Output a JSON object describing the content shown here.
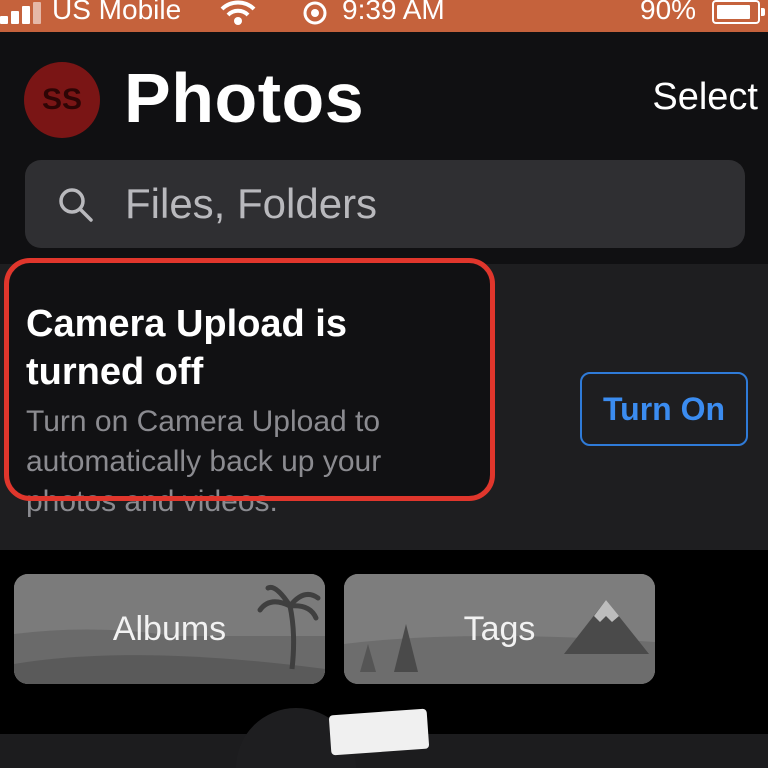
{
  "status_bar": {
    "carrier": "US Mobile",
    "time": "9:39 AM",
    "battery": "90%",
    "battery_level": 0.9
  },
  "header": {
    "avatar_initials": "SS",
    "title": "Photos",
    "select_label": "Select"
  },
  "search": {
    "placeholder": "Files, Folders"
  },
  "camera_upload": {
    "title": "Camera Upload is turned off",
    "description": "Turn on Camera Upload to automatically back up your photos and videos.",
    "button_label": "Turn On"
  },
  "tiles": [
    {
      "label": "Albums"
    },
    {
      "label": "Tags"
    }
  ],
  "colors": {
    "status_bar": "#c5623c",
    "background": "#101012",
    "accent_blue": "#3b8cf0",
    "highlight_red": "#e0362c",
    "avatar": "#7a1515"
  },
  "icons": [
    "signal-icon",
    "wifi-icon",
    "alarm-icon",
    "battery-icon",
    "search-icon",
    "palm-tree-icon",
    "mountain-icon"
  ]
}
